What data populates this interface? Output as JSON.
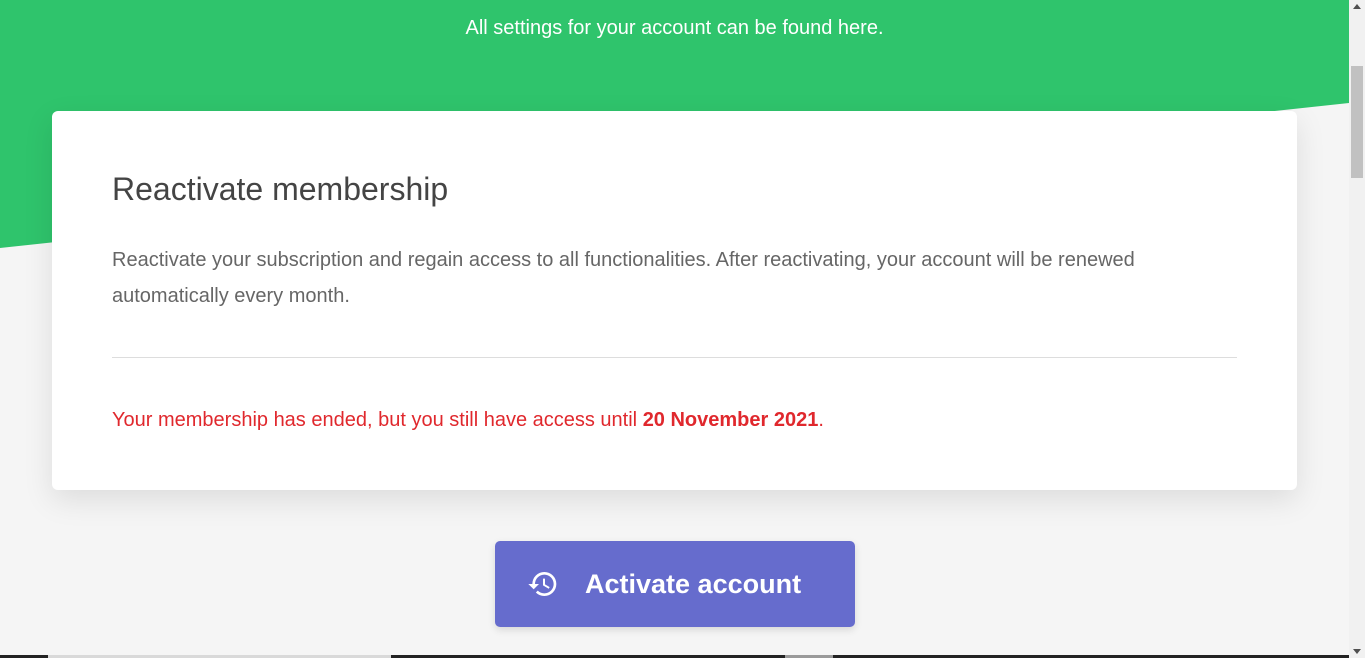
{
  "hero": {
    "subtitle": "All settings for your account can be found here.",
    "background_color": "#2fc46c"
  },
  "card": {
    "title": "Reactivate membership",
    "description": "Reactivate your subscription and regain access to all functionalities. After reactivating, your account will be renewed automatically every month.",
    "status": {
      "text": "Your membership has ended, but you still have access until ",
      "date": "20 November 2021",
      "suffix": ".",
      "color": "#e0282d"
    }
  },
  "activate_button": {
    "label": "Activate account",
    "icon": "history-icon",
    "color": "#666ccd"
  }
}
